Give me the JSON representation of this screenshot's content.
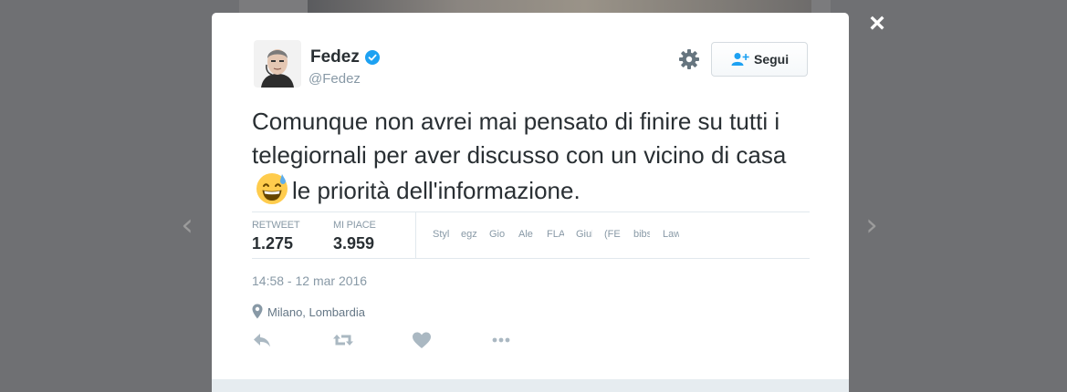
{
  "lightbox": {
    "close_label": "×",
    "prev_label": "‹",
    "next_label": "›"
  },
  "user": {
    "name": "Fedez",
    "handle": "@Fedez",
    "verified": true
  },
  "follow_button": {
    "label": "Segui",
    "icon": "add-user-icon"
  },
  "tweet": {
    "text_before_emoji": "Comunque non avrei mai pensato di finire su tutti i telegiornali per aver discusso con un vicino di casa",
    "emoji": "grinning-face-with-sweat-emoji",
    "text_after_emoji": "le priorità dell'informazione."
  },
  "stats": {
    "retweet_label": "RETWEET",
    "retweet_count": "1.275",
    "likes_label": "MI PIACE",
    "likes_count": "3.959"
  },
  "likers": [
    "Styl",
    "egz",
    "Gio",
    "Ale",
    "FLA",
    "Giul",
    "(FE",
    "bibs",
    "Law"
  ],
  "timestamp": "14:58 - 12 mar 2016",
  "location": "Milano, Lombardia",
  "actions": [
    "reply-icon",
    "retweet-icon",
    "heart-icon",
    "more-icon"
  ],
  "colors": {
    "overlay": "#6f7073",
    "text": "#292f33",
    "muted": "#8899a6",
    "verified": "#1da1f2",
    "follow_icon": "#1da1f2"
  }
}
